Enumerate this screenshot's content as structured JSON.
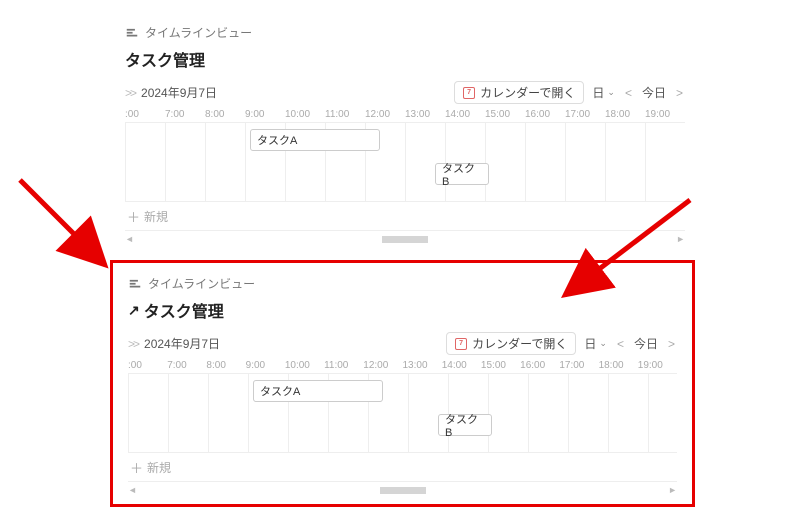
{
  "view_label": "タイムラインビュー",
  "title": "タスク管理",
  "date": "2024年9月7日",
  "calendar_open_label": "カレンダーで開く",
  "calendar_icon_text": "7",
  "range_label": "日",
  "today_label": "今日",
  "new_label": "新規",
  "time_ticks": [
    ":00",
    "7:00",
    "8:00",
    "9:00",
    "10:00",
    "11:00",
    "12:00",
    "13:00",
    "14:00",
    "15:00",
    "16:00",
    "17:00",
    "18:00",
    "19:00"
  ],
  "tasks": {
    "a": {
      "label": "タスクA"
    },
    "b": {
      "label": "タスクB"
    }
  }
}
